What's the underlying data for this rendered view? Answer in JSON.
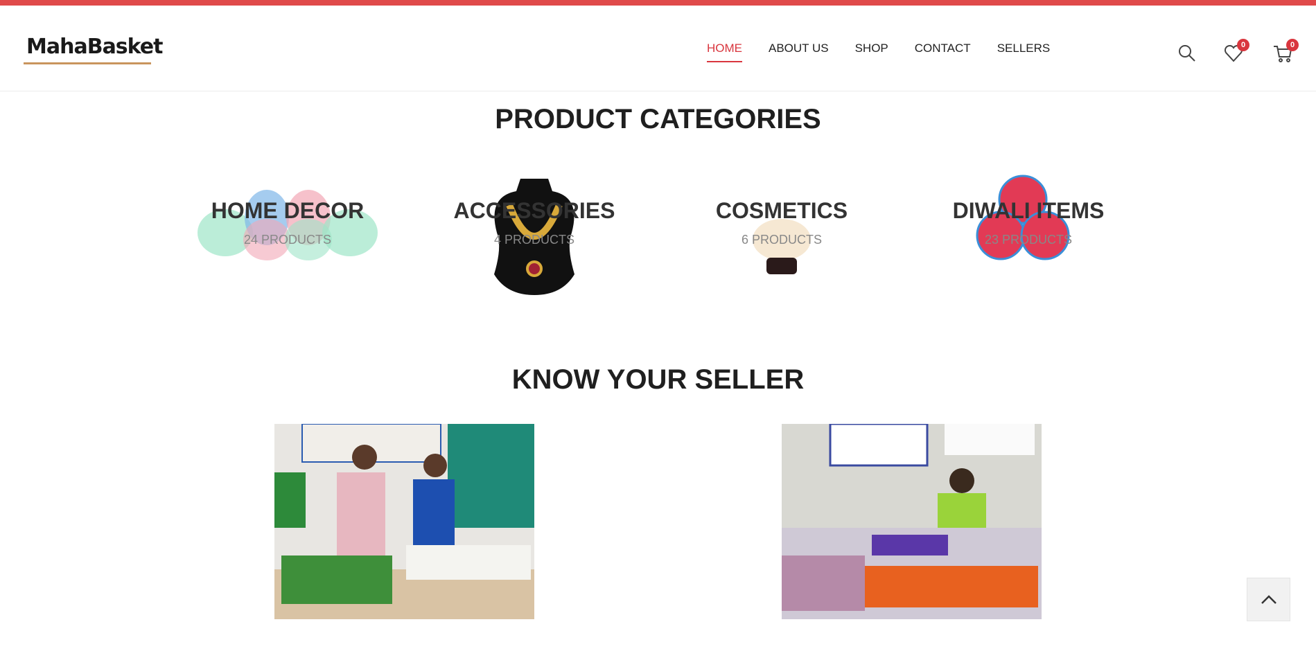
{
  "header": {
    "logo_text": "MahaBasket",
    "nav": [
      "HOME",
      "ABOUT US",
      "SHOP",
      "CONTACT",
      "SELLERS"
    ],
    "active_nav": "HOME",
    "wishlist_count": "0",
    "cart_count": "0",
    "accent_color": "#d9363e"
  },
  "categories": {
    "title": "PRODUCT CATEGORIES",
    "items": [
      {
        "name": "HOME DECOR",
        "count": "24 PRODUCTS"
      },
      {
        "name": "ACCESSORIES",
        "count": "4 PRODUCTS"
      },
      {
        "name": "COSMETICS",
        "count": "6 PRODUCTS"
      },
      {
        "name": "DIWALI ITEMS",
        "count": "23 PRODUCTS"
      }
    ]
  },
  "sellers": {
    "title": "KNOW YOUR SELLER"
  },
  "icons": [
    "search-icon",
    "heart-icon",
    "cart-icon",
    "chevron-up-icon"
  ]
}
